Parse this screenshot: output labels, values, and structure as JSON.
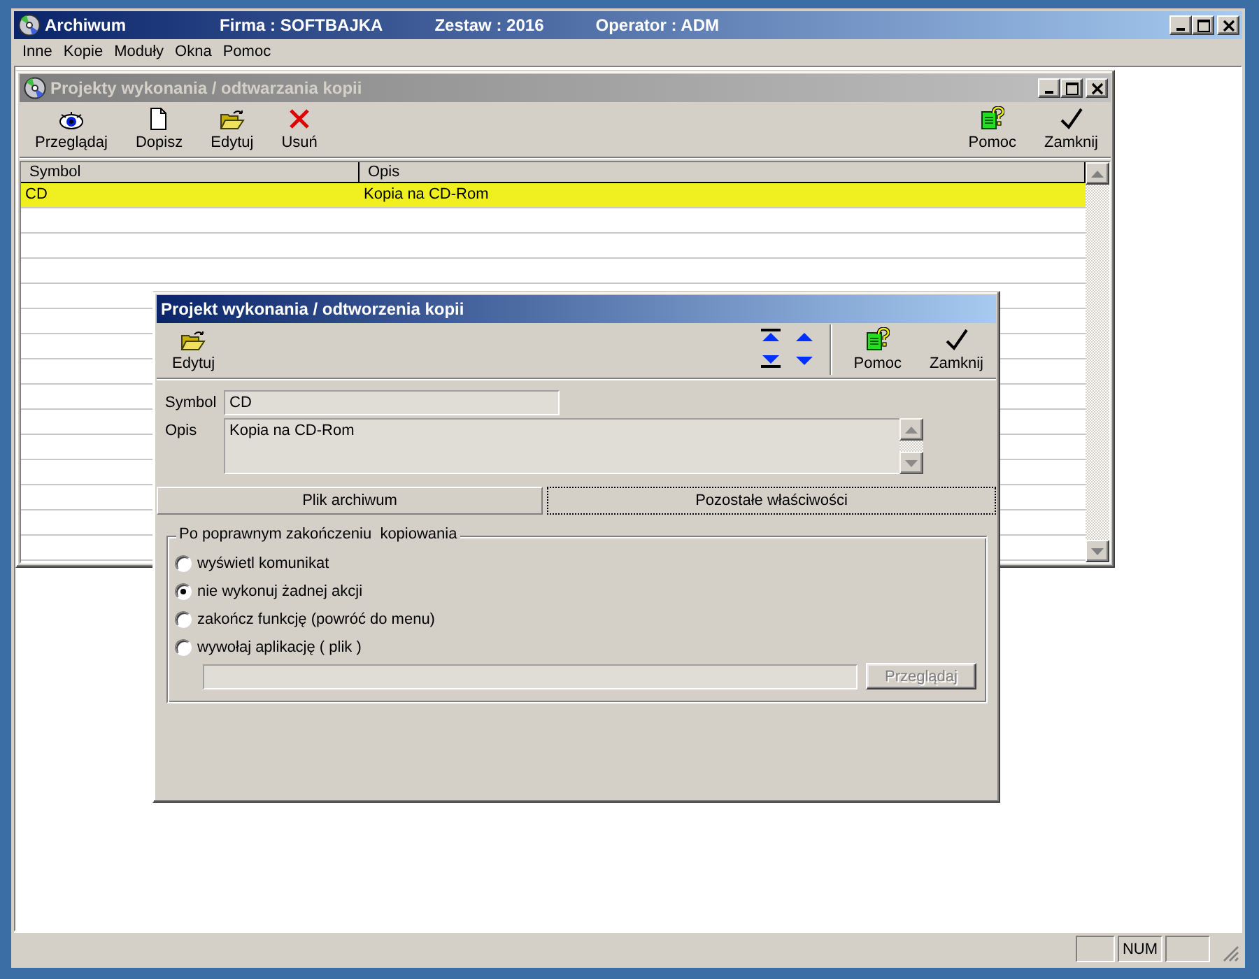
{
  "main_window": {
    "title": "Archiwum",
    "firma": "Firma : SOFTBAJKA",
    "zestaw": "Zestaw : 2016",
    "operator": "Operator : ADM"
  },
  "menu": [
    "Inne",
    "Kopie",
    "Moduły",
    "Okna",
    "Pomoc"
  ],
  "list_window": {
    "title": "Projekty wykonania / odtwarzania kopii",
    "active": false,
    "toolbar_left": [
      {
        "label": "Przeglądaj",
        "kind": "view"
      },
      {
        "label": "Dopisz",
        "kind": "add"
      },
      {
        "label": "Edytuj",
        "kind": "edit"
      },
      {
        "label": "Usuń",
        "kind": "delete"
      }
    ],
    "toolbar_right": [
      {
        "label": "Pomoc",
        "kind": "help"
      },
      {
        "label": "Zamknij",
        "kind": "close"
      }
    ],
    "table": {
      "columns": [
        "Symbol",
        "Opis"
      ],
      "rows": [
        {
          "cells": [
            "CD",
            "Kopia na CD-Rom"
          ],
          "selected": true
        }
      ]
    }
  },
  "dialog": {
    "title": "Projekt wykonania / odtworzenia kopii",
    "active": true,
    "toolbar_left": [
      {
        "label": "Edytuj",
        "kind": "edit"
      }
    ],
    "toolbar_right": [
      {
        "label": "Pomoc",
        "kind": "help"
      },
      {
        "label": "Zamknij",
        "kind": "close"
      }
    ],
    "symbol_label": "Symbol",
    "symbol_value": "CD",
    "opis_label": "Opis",
    "opis_value": "Kopia na CD-Rom",
    "tabs": [
      {
        "label": "Plik archiwum",
        "selected": false
      },
      {
        "label": "Pozostałe właściwości",
        "selected": true
      }
    ],
    "group": {
      "title": "Po poprawnym zakończeniu  kopiowania",
      "options": [
        {
          "label": "wyświetl komunikat",
          "selected": false
        },
        {
          "label": "nie wykonuj żadnej akcji",
          "selected": true
        },
        {
          "label": "zakończ funkcję (powróć do menu)",
          "selected": false
        },
        {
          "label": "wywołaj aplikację ( plik )",
          "selected": false
        }
      ],
      "browse_button": {
        "label": "Przeglądaj",
        "disabled": true
      }
    }
  },
  "status_bar": {
    "num": "NUM"
  }
}
